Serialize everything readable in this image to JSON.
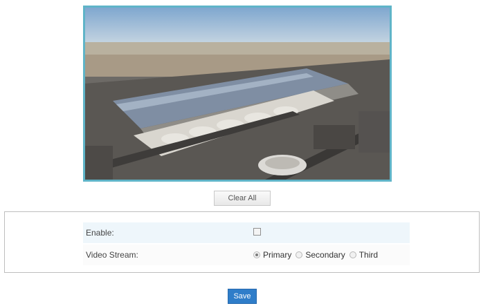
{
  "preview": {
    "image_description_icon": "airport-terminal-aerial-photo"
  },
  "clear_all_label": "Clear All",
  "settings": {
    "enable_label": "Enable:",
    "enable_checked": false,
    "video_stream_label": "Video Stream:",
    "video_stream_options": [
      {
        "label": "Primary",
        "selected": true
      },
      {
        "label": "Secondary",
        "selected": false
      },
      {
        "label": "Third",
        "selected": false
      }
    ]
  },
  "save_label": "Save",
  "colors": {
    "preview_border": "#5fb4c8",
    "save_button": "#2f7dc9",
    "enable_row_bg": "#eef6fb"
  }
}
